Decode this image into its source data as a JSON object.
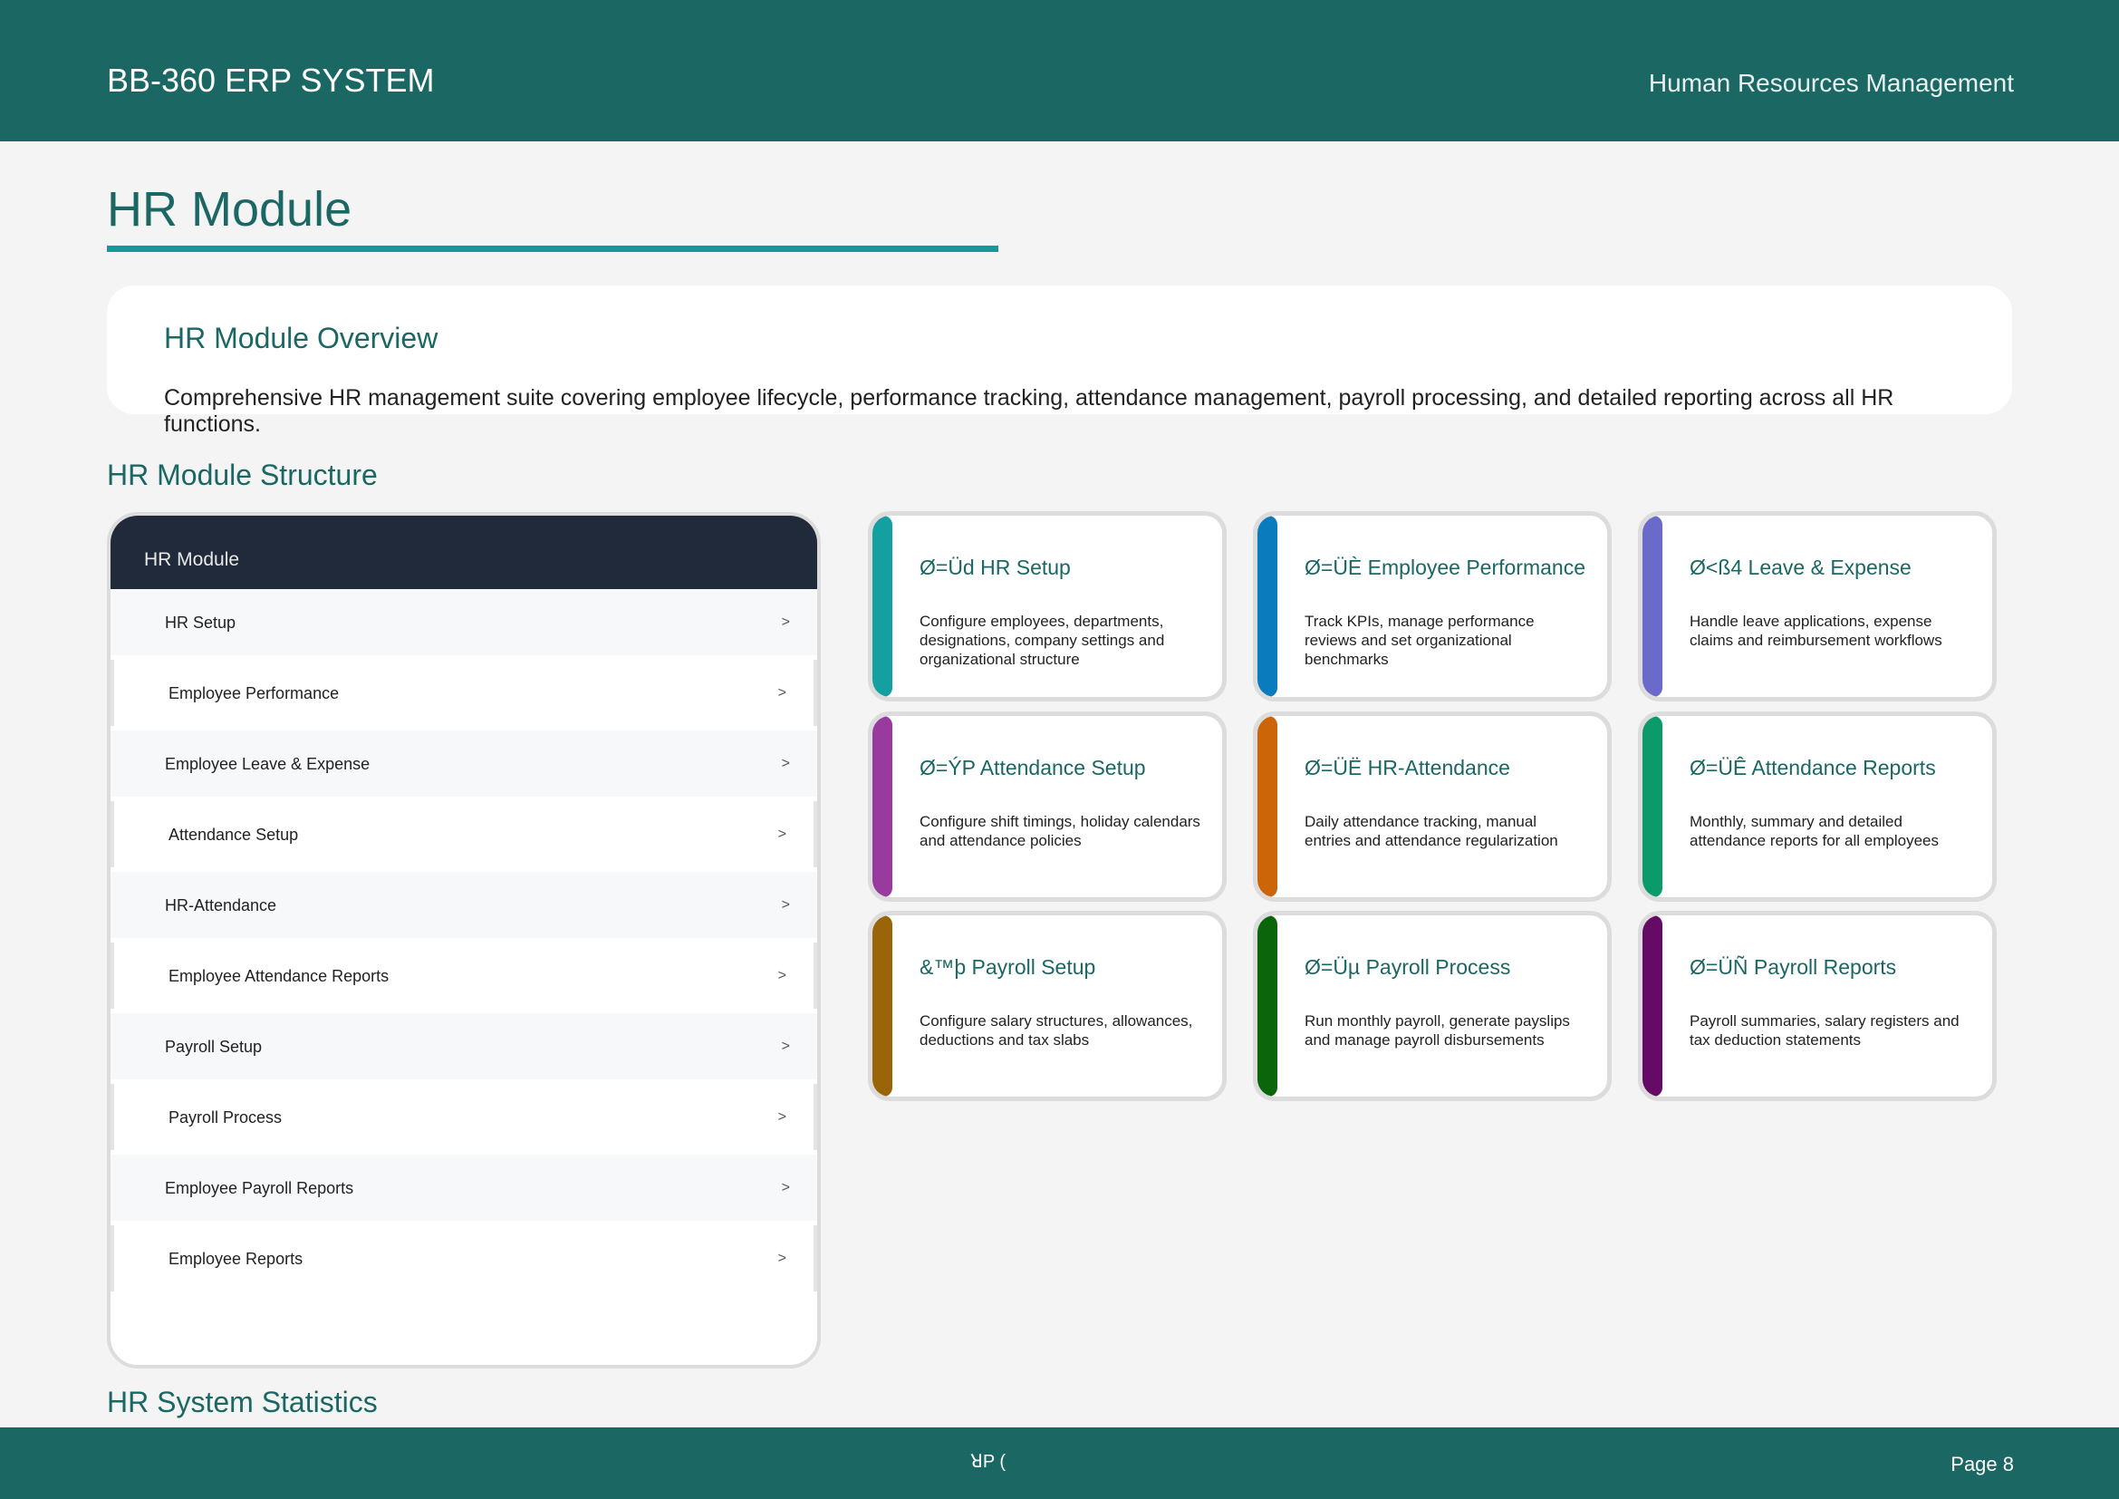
{
  "header": {
    "title": "BB-360 ERP SYSTEM",
    "subtitle": "Human Resources Management"
  },
  "page_title": "HR Module",
  "overview": {
    "title": "HR Module Overview",
    "text": "Comprehensive HR management suite covering employee lifecycle, performance tracking, attendance management, payroll processing, and detailed reporting across all HR functions."
  },
  "structure": {
    "section_title": "HR Module Structure",
    "panel_title": "HR Module",
    "arrow": ">",
    "items": [
      {
        "label": "HR Setup"
      },
      {
        "label": "Employee Performance"
      },
      {
        "label": "Employee Leave & Expense"
      },
      {
        "label": "Attendance Setup"
      },
      {
        "label": "HR-Attendance"
      },
      {
        "label": "Employee Attendance Reports"
      },
      {
        "label": "Payroll Setup"
      },
      {
        "label": "Payroll Process"
      },
      {
        "label": "Employee Payroll Reports"
      },
      {
        "label": "Employee Reports"
      }
    ]
  },
  "cards": [
    {
      "title": "Ø=Üd HR Setup",
      "desc": "Configure employees, departments, designations, company settings and organizational structure",
      "color": "#14a0a0"
    },
    {
      "title": "Ø=ÜÈ Employee Performance",
      "desc": "Track KPIs, manage performance reviews and set organizational benchmarks",
      "color": "#0a7bbd"
    },
    {
      "title": "Ø<ß4 Leave & Expense",
      "desc": "Handle leave applications, expense claims and reimbursement workflows",
      "color": "#6a6acb"
    },
    {
      "title": "Ø=ÝP Attendance Setup",
      "desc": "Configure shift timings, holiday calendars and attendance policies",
      "color": "#983a9e"
    },
    {
      "title": "Ø=ÜË HR-Attendance",
      "desc": "Daily attendance tracking, manual entries and attendance regularization",
      "color": "#cc6508"
    },
    {
      "title": "Ø=ÜÊ Attendance Reports",
      "desc": "Monthly, summary and detailed attendance reports for all employees",
      "color": "#0b9a6a"
    },
    {
      "title": "&™þ Payroll Setup",
      "desc": "Configure salary structures, allowances, deductions and tax slabs",
      "color": "#9a6508"
    },
    {
      "title": "Ø=Üµ Payroll Process",
      "desc": "Run monthly payroll, generate payslips and manage payroll disbursements",
      "color": "#0b650b"
    },
    {
      "title": "Ø=ÜÑ Payroll Reports",
      "desc": "Payroll summaries, salary registers and tax deduction statements",
      "color": "#650b65"
    }
  ],
  "stats_title": "HR System Statistics",
  "footer": {
    "center": "ꓤP (",
    "page": "Page 8"
  }
}
